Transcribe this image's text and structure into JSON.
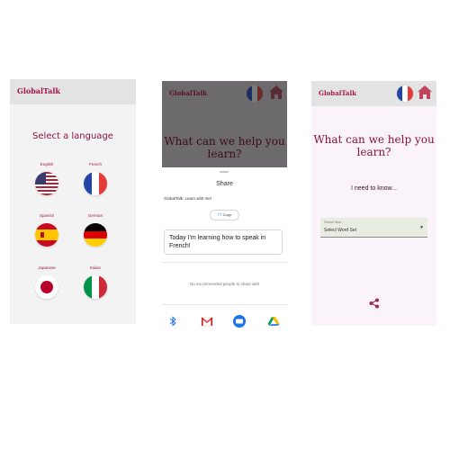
{
  "screen1": {
    "brand": "GlobalTalk",
    "heading": "Select a language",
    "languages": [
      {
        "label": "English",
        "flag": "us-flag-icon"
      },
      {
        "label": "French",
        "flag": "fr-flag-icon"
      },
      {
        "label": "Spanish",
        "flag": "es-flag-icon"
      },
      {
        "label": "German",
        "flag": "de-flag-icon"
      },
      {
        "label": "Japanese",
        "flag": "jp-flag-icon"
      },
      {
        "label": "Italian",
        "flag": "it-flag-icon"
      }
    ]
  },
  "screen2": {
    "brand": "GlobalTalk",
    "question": "What can we help you learn?",
    "share_title": "Share",
    "share_text": "GlobalTalk: Learn with me!",
    "copy_label": "Copy",
    "message": "Today I'm learning how to speak in French!",
    "no_recommend": "No recommended people to share with",
    "share_targets": [
      "bluetooth-icon",
      "gmail-icon",
      "messages-icon",
      "drive-icon"
    ]
  },
  "screen3": {
    "brand": "GlobalTalk",
    "question": "What can we help you learn?",
    "need": "I need to know...",
    "select_label": "Select Item",
    "select_value": "Select Word Set"
  },
  "colors": {
    "brand": "#a0174a",
    "appbar": "#e4e3e4",
    "overlay": "#6c6a6c",
    "home": "#c0445e"
  }
}
